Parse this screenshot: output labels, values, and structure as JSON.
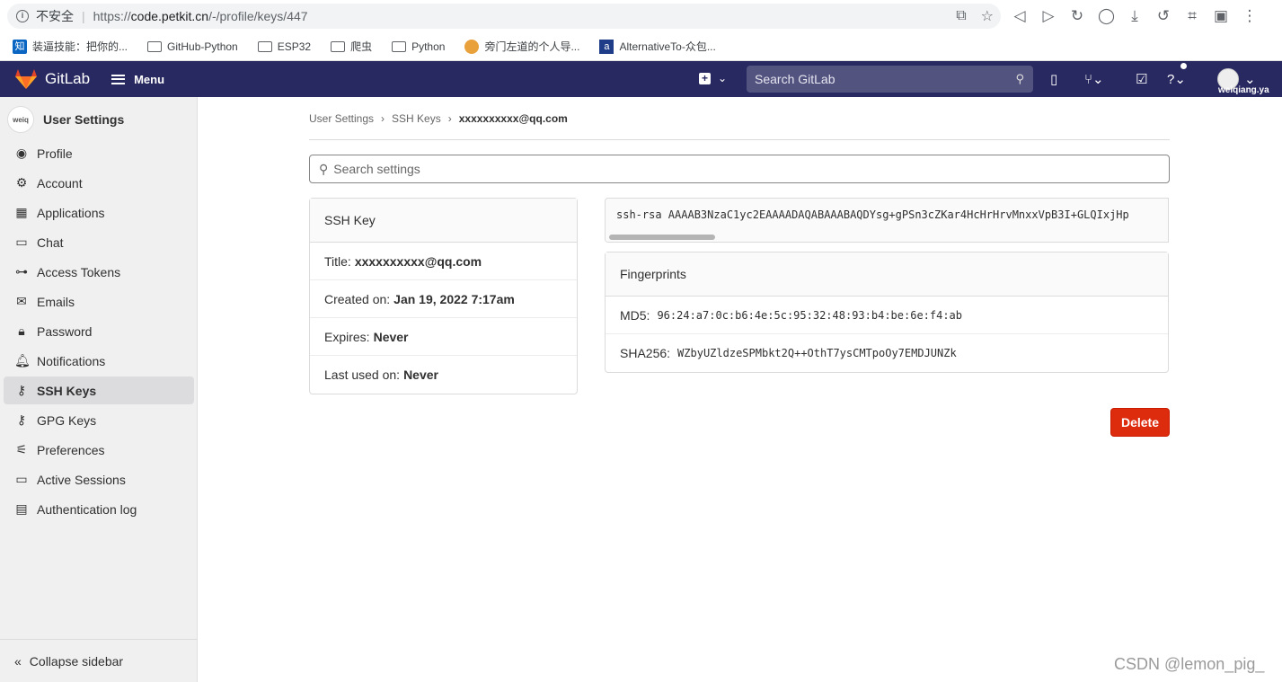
{
  "browser": {
    "insecure_label": "不安全",
    "url_prefix": "https://",
    "url_host": "code.petkit.cn",
    "url_path": "/-/profile/keys/447",
    "bookmarks": [
      {
        "label": "装逼技能：把你的..."
      },
      {
        "label": "GitHub-Python"
      },
      {
        "label": "ESP32"
      },
      {
        "label": "爬虫"
      },
      {
        "label": "Python"
      },
      {
        "label": "旁门左道的个人导..."
      },
      {
        "label": "AlternativeTo-众包..."
      }
    ]
  },
  "topnav": {
    "brand": "GitLab",
    "menu_label": "Menu",
    "search_placeholder": "Search GitLab",
    "username": "weiqiang.ya"
  },
  "sidebar": {
    "title": "User Settings",
    "avatar_alt": "weiq",
    "items": [
      {
        "label": "Profile",
        "icon": "profile-icon"
      },
      {
        "label": "Account",
        "icon": "account-icon"
      },
      {
        "label": "Applications",
        "icon": "applications-icon"
      },
      {
        "label": "Chat",
        "icon": "chat-icon"
      },
      {
        "label": "Access Tokens",
        "icon": "token-icon"
      },
      {
        "label": "Emails",
        "icon": "mail-icon"
      },
      {
        "label": "Password",
        "icon": "lock-icon"
      },
      {
        "label": "Notifications",
        "icon": "bell-icon"
      },
      {
        "label": "SSH Keys",
        "icon": "key-icon",
        "active": true
      },
      {
        "label": "GPG Keys",
        "icon": "key-icon"
      },
      {
        "label": "Preferences",
        "icon": "preferences-icon"
      },
      {
        "label": "Active Sessions",
        "icon": "monitor-icon"
      },
      {
        "label": "Authentication log",
        "icon": "log-icon"
      }
    ],
    "collapse_label": "Collapse sidebar"
  },
  "breadcrumb": {
    "items": [
      "User Settings",
      "SSH Keys"
    ],
    "current": "xxxxxxxxxx@qq.com"
  },
  "search_settings_placeholder": "Search settings",
  "ssh_key_card": {
    "header": "SSH Key",
    "title_label": "Title:",
    "title_value": "xxxxxxxxxx@qq.com",
    "created_label": "Created on:",
    "created_value": "Jan 19, 2022 7:17am",
    "expires_label": "Expires:",
    "expires_value": "Never",
    "last_used_label": "Last used on:",
    "last_used_value": "Never"
  },
  "public_key": "ssh-rsa AAAAB3NzaC1yc2EAAAADAQABAAABAQDYsg+gPSn3cZKar4HcHrHrvMnxxVpB3I+GLQIxjHp",
  "fingerprints": {
    "header": "Fingerprints",
    "md5_label": "MD5:",
    "md5_value": "96:24:a7:0c:b6:4e:5c:95:32:48:93:b4:be:6e:f4:ab",
    "sha256_label": "SHA256:",
    "sha256_value": "WZbyUZldzeSPMbkt2Q++OthT7ysCMTpoOy7EMDJUNZk"
  },
  "delete_label": "Delete",
  "watermark": "CSDN @lemon_pig_",
  "colors": {
    "nav_bg": "#292961",
    "delete_bg": "#dd2b0e",
    "sidebar_bg": "#f0f0f0"
  }
}
